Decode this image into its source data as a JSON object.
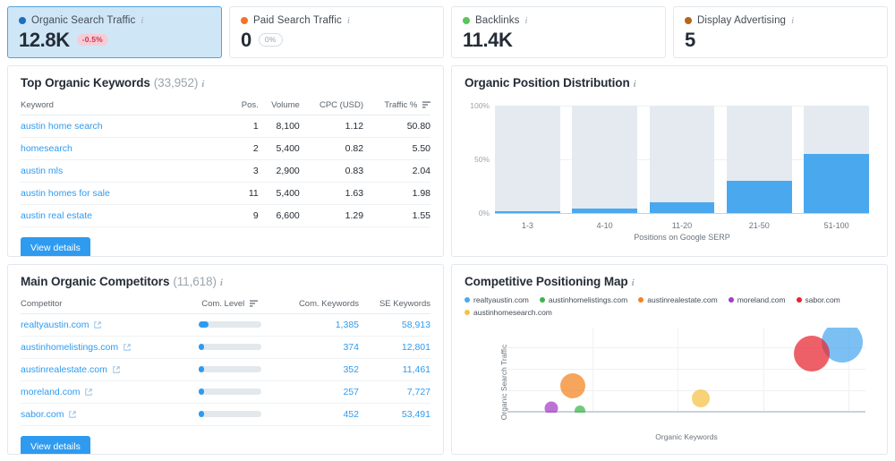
{
  "kpis": [
    {
      "label": "Organic Search Traffic",
      "value": "12.8K",
      "badge": "-0.5%",
      "badge_type": "neg",
      "dot_color": "#1b6ec2",
      "selected": true,
      "info": "i"
    },
    {
      "label": "Paid Search Traffic",
      "value": "0",
      "badge": "0%",
      "badge_type": "zero",
      "dot_color": "#f2722b",
      "selected": false,
      "info": "i"
    },
    {
      "label": "Backlinks",
      "value": "11.4K",
      "badge": "",
      "badge_type": "none",
      "dot_color": "#5cc45c",
      "selected": false,
      "info": "i"
    },
    {
      "label": "Display Advertising",
      "value": "5",
      "badge": "",
      "badge_type": "none",
      "dot_color": "#b5651d",
      "selected": false,
      "info": "i"
    }
  ],
  "keywords_panel": {
    "title": "Top Organic Keywords",
    "count": "(33,952)",
    "info": "i",
    "columns": [
      "Keyword",
      "Pos.",
      "Volume",
      "CPC (USD)",
      "Traffic %"
    ],
    "sorted_column": "Traffic %",
    "rows": [
      {
        "keyword": "austin home search",
        "pos": "1",
        "volume": "8,100",
        "cpc": "1.12",
        "traffic": "50.80"
      },
      {
        "keyword": "homesearch",
        "pos": "2",
        "volume": "5,400",
        "cpc": "0.82",
        "traffic": "5.50"
      },
      {
        "keyword": "austin mls",
        "pos": "3",
        "volume": "2,900",
        "cpc": "0.83",
        "traffic": "2.04"
      },
      {
        "keyword": "austin homes for sale",
        "pos": "11",
        "volume": "5,400",
        "cpc": "1.63",
        "traffic": "1.98"
      },
      {
        "keyword": "austin real estate",
        "pos": "9",
        "volume": "6,600",
        "cpc": "1.29",
        "traffic": "1.55"
      }
    ],
    "button": "View details"
  },
  "competitors_panel": {
    "title": "Main Organic Competitors",
    "count": "(11,618)",
    "info": "i",
    "columns": [
      "Competitor",
      "Com. Level",
      "Com. Keywords",
      "SE Keywords"
    ],
    "sorted_column": "Com. Level",
    "rows": [
      {
        "competitor": "realtyaustin.com",
        "level_pct": 16,
        "com_keywords": "1,385",
        "se_keywords": "58,913"
      },
      {
        "competitor": "austinhomelistings.com",
        "level_pct": 9,
        "com_keywords": "374",
        "se_keywords": "12,801"
      },
      {
        "competitor": "austinrealestate.com",
        "level_pct": 9,
        "com_keywords": "352",
        "se_keywords": "11,461"
      },
      {
        "competitor": "moreland.com",
        "level_pct": 9,
        "com_keywords": "257",
        "se_keywords": "7,727"
      },
      {
        "competitor": "sabor.com",
        "level_pct": 9,
        "com_keywords": "452",
        "se_keywords": "53,491"
      }
    ],
    "button": "View details"
  },
  "position_panel": {
    "title": "Organic Position Distribution",
    "info": "i"
  },
  "positioning_panel": {
    "title": "Competitive Positioning Map",
    "info": "i",
    "legend": [
      {
        "label": "realtyaustin.com",
        "color": "#4aa8ef"
      },
      {
        "label": "austinhomelistings.com",
        "color": "#3cb54a"
      },
      {
        "label": "austinrealestate.com",
        "color": "#f58220"
      },
      {
        "label": "moreland.com",
        "color": "#a53dc4"
      },
      {
        "label": "sabor.com",
        "color": "#e8242f"
      },
      {
        "label": "austinhomesearch.com",
        "color": "#f5c242"
      }
    ]
  },
  "chart_data": [
    {
      "type": "bar",
      "title": "Organic Position Distribution",
      "categories": [
        "1-3",
        "4-10",
        "11-20",
        "21-50",
        "51-100"
      ],
      "values": [
        1,
        4,
        10,
        30,
        55
      ],
      "background_values": [
        100,
        100,
        100,
        100,
        100
      ],
      "xlabel": "Positions on Google SERP",
      "ylabel": "",
      "ylim": [
        0,
        100
      ],
      "yticks": [
        "0%",
        "50%",
        "100%"
      ],
      "ytick_values": [
        0,
        50,
        100
      ],
      "grid": true,
      "legend": "none",
      "bar_color": "#4aa8ef",
      "track_color": "#e4eaf0"
    },
    {
      "type": "scatter",
      "title": "Competitive Positioning Map",
      "xlabel": "Organic Keywords",
      "ylabel": "Organic Search Traffic",
      "xlim": [
        0,
        63000
      ],
      "ylim": [
        0,
        80000
      ],
      "xticks": [
        "0",
        "15K",
        "30K",
        "45K",
        "60K"
      ],
      "xtick_values": [
        0,
        15000,
        30000,
        45000,
        60000
      ],
      "yticks": [
        "0",
        "20K",
        "40K",
        "60K",
        "80K"
      ],
      "ytick_values": [
        0,
        20000,
        40000,
        60000,
        80000
      ],
      "grid": true,
      "legend": "top",
      "points": [
        {
          "name": "realtyaustin.com",
          "x": 58913,
          "y": 66000,
          "size": 46,
          "color": "#4aa8ef"
        },
        {
          "name": "sabor.com",
          "x": 53491,
          "y": 55000,
          "size": 40,
          "color": "#e8242f"
        },
        {
          "name": "austinhomesearch.com",
          "x": 34000,
          "y": 13000,
          "size": 20,
          "color": "#f5c242"
        },
        {
          "name": "austinrealestate.com",
          "x": 11461,
          "y": 25000,
          "size": 28,
          "color": "#f58220"
        },
        {
          "name": "moreland.com",
          "x": 7727,
          "y": 4000,
          "size": 15,
          "color": "#a53dc4"
        },
        {
          "name": "austinhomelistings.com",
          "x": 12801,
          "y": 2000,
          "size": 12,
          "color": "#3cb54a"
        }
      ]
    }
  ]
}
